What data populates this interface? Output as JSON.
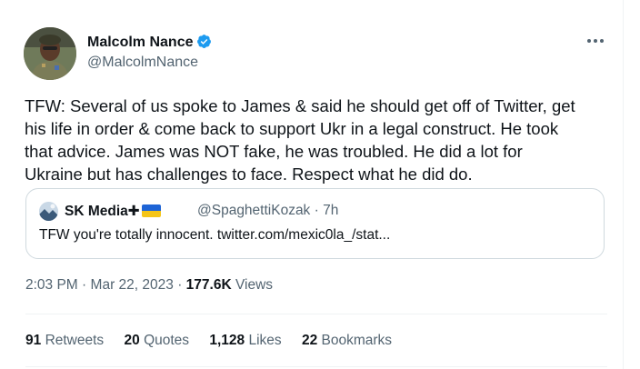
{
  "author": {
    "display_name": "Malcolm Nance",
    "handle": "@MalcolmNance",
    "verified": true
  },
  "tweet": {
    "text_lines": [
      "TFW: Several of us spoke to James & said he should get off of Twitter, get",
      "his life in order & come back to support Ukr in a legal construct.  He took",
      "that advice.  James was NOT fake, he was troubled.  He did a lot for",
      "Ukraine but has challenges to face.  Respect what he did do."
    ]
  },
  "quote": {
    "display_name": "SK Media",
    "name_suffix_glyph": "✚",
    "handle": "@SpaghettiKozak",
    "separator": "·",
    "age": "7h",
    "text": "TFW you're totally innocent. twitter.com/mexic0la_/stat..."
  },
  "meta": {
    "time": "2:03 PM",
    "sep1": "·",
    "date": "Mar 22, 2023",
    "sep2": "·",
    "views_count": "177.6K",
    "views_label": "Views"
  },
  "stats": {
    "retweets_count": "91",
    "retweets_label": "Retweets",
    "quotes_count": "20",
    "quotes_label": "Quotes",
    "likes_count": "1,128",
    "likes_label": "Likes",
    "bookmarks_count": "22",
    "bookmarks_label": "Bookmarks"
  },
  "colors": {
    "text_primary": "#0f1419",
    "text_secondary": "#536471",
    "border": "#cfd9de",
    "verified_blue": "#1d9bf0",
    "flag_blue": "#1e64d6",
    "flag_yellow": "#f5c518"
  },
  "icons": {
    "verified": "verified-badge-icon",
    "more": "more-options-icon",
    "flag": "ukraine-flag-icon"
  }
}
